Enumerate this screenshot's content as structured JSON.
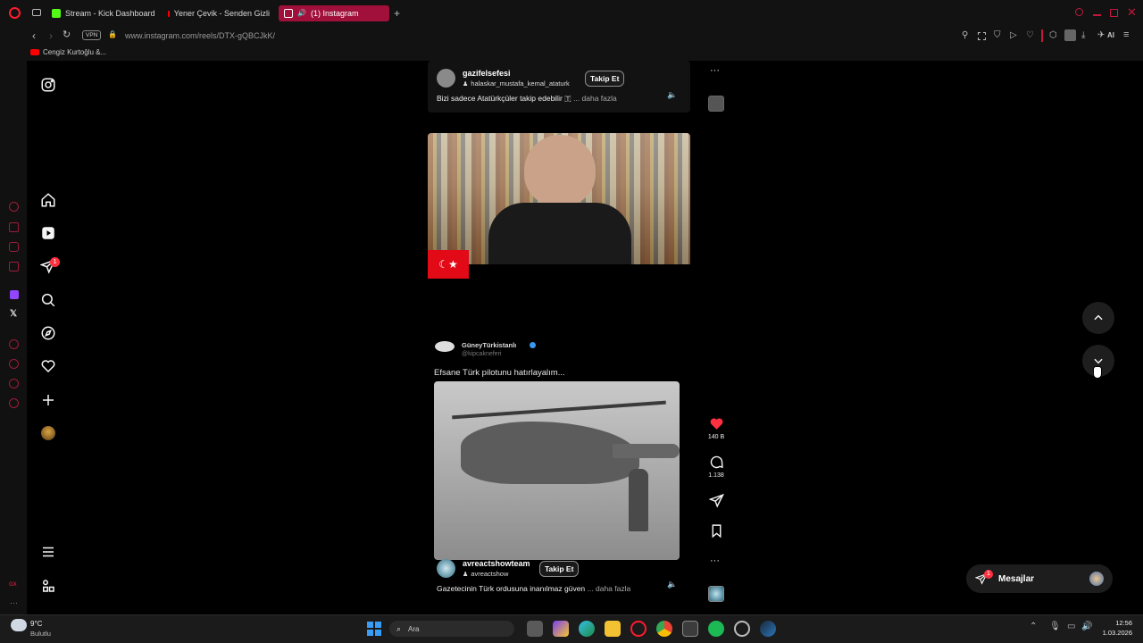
{
  "browser": {
    "tabs": [
      {
        "label": "Stream - Kick Dashboard",
        "color": "#53fc18"
      },
      {
        "label": "Yener Çevik - Senden Gizli",
        "color": "#ff0000"
      },
      {
        "label": "(1) Instagram",
        "color": "#ff2d6a"
      }
    ],
    "vpn_badge": "VPN",
    "url": "www.instagram.com/reels/DTX-gQBCJkK/",
    "bookmark": "Cengiz Kurtoğlu &...",
    "ai_label": "AI"
  },
  "instagram": {
    "nav_badge": "1",
    "reel_top": {
      "username": "gazifelsefesi",
      "music": "halaskar_mustafa_kemal_ataturk",
      "follow_label": "Takip Et",
      "caption": "Bizi sadece Atatürkçüler takip edebilir 🇹",
      "more": "... daha fazla"
    },
    "reel_main": {
      "inner_account_name": "GüneyTürkistanlı",
      "inner_account_handle": "@kipcakneferi",
      "inner_caption": "Efsane Türk pilotunu hatırlayalım...",
      "username": "avreactshowteam",
      "music": "avreactshow",
      "follow_label": "Takip Et",
      "caption": "Gazetecinin Türk ordusuna inanılmaz güven",
      "more": "... daha fazla"
    },
    "actions": {
      "likes": "140 B",
      "comments": "1.138"
    },
    "messages": {
      "label": "Mesajlar",
      "badge": "1"
    }
  },
  "taskbar": {
    "weather_temp": "9°C",
    "weather_desc": "Bulutlu",
    "search_label": "Ara",
    "time": "12:56",
    "date": "1.03.2026"
  },
  "colors": {
    "accent": "#a0103a",
    "like": "#ff3040",
    "badge": "#ff3040"
  }
}
